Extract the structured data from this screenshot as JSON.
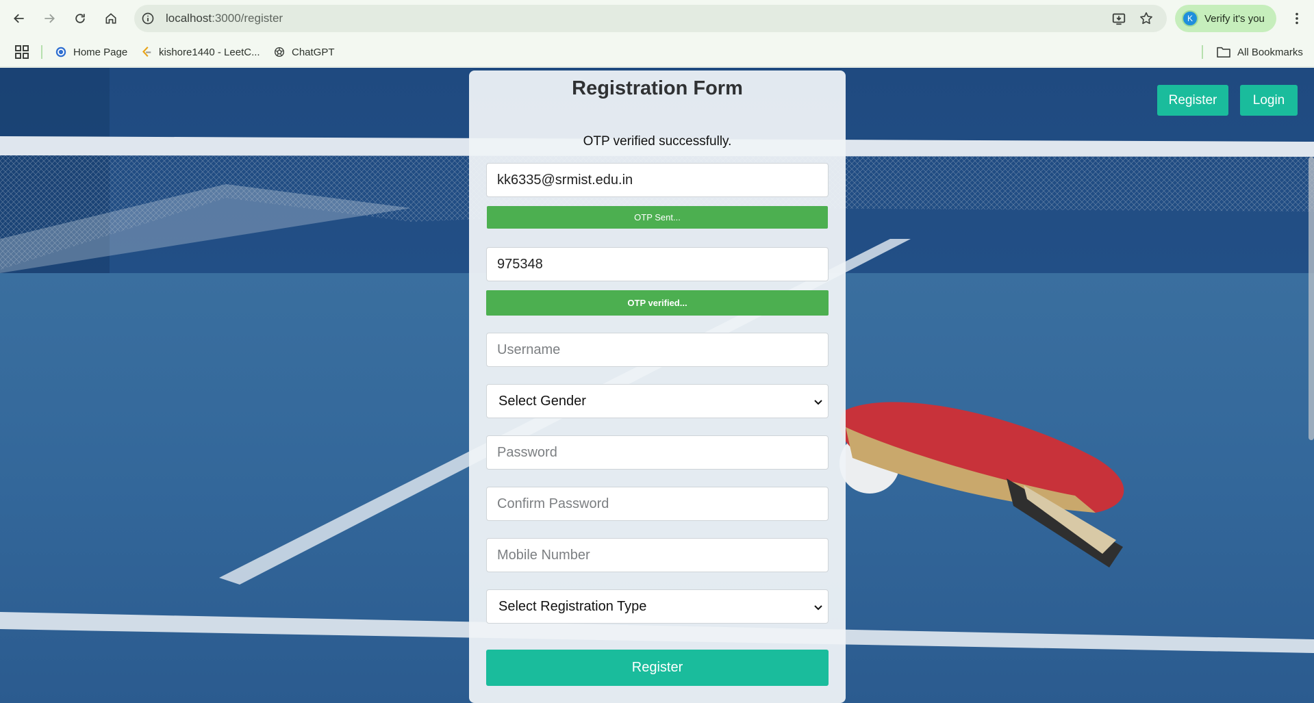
{
  "browser": {
    "url_host": "localhost",
    "url_path": ":3000/register",
    "profile_initial": "K",
    "profile_label": "Verify it's you",
    "bookmarks": [
      {
        "label": "Home Page",
        "icon": "home-page-favicon"
      },
      {
        "label": "kishore1440 - LeetC...",
        "icon": "leetcode-icon"
      },
      {
        "label": "ChatGPT",
        "icon": "chatgpt-icon"
      }
    ],
    "all_bookmarks_label": "All Bookmarks"
  },
  "nav": {
    "register_label": "Register",
    "login_label": "Login"
  },
  "form": {
    "title": "Registration Form",
    "status_message": "OTP verified successfully.",
    "email_value": "kk6335@srmist.edu.in",
    "otp_sent_label": "OTP Sent...",
    "otp_value": "975348",
    "otp_verified_label": "OTP verified...",
    "username_placeholder": "Username",
    "gender_selected": "Select Gender",
    "password_placeholder": "Password",
    "confirm_password_placeholder": "Confirm Password",
    "mobile_placeholder": "Mobile Number",
    "registration_type_selected": "Select Registration Type",
    "submit_label": "Register"
  },
  "colors": {
    "accent": "#1abc9c",
    "success": "#4caf50",
    "table_blue": "#2e5c8e",
    "paddle_red": "#c8323a"
  }
}
